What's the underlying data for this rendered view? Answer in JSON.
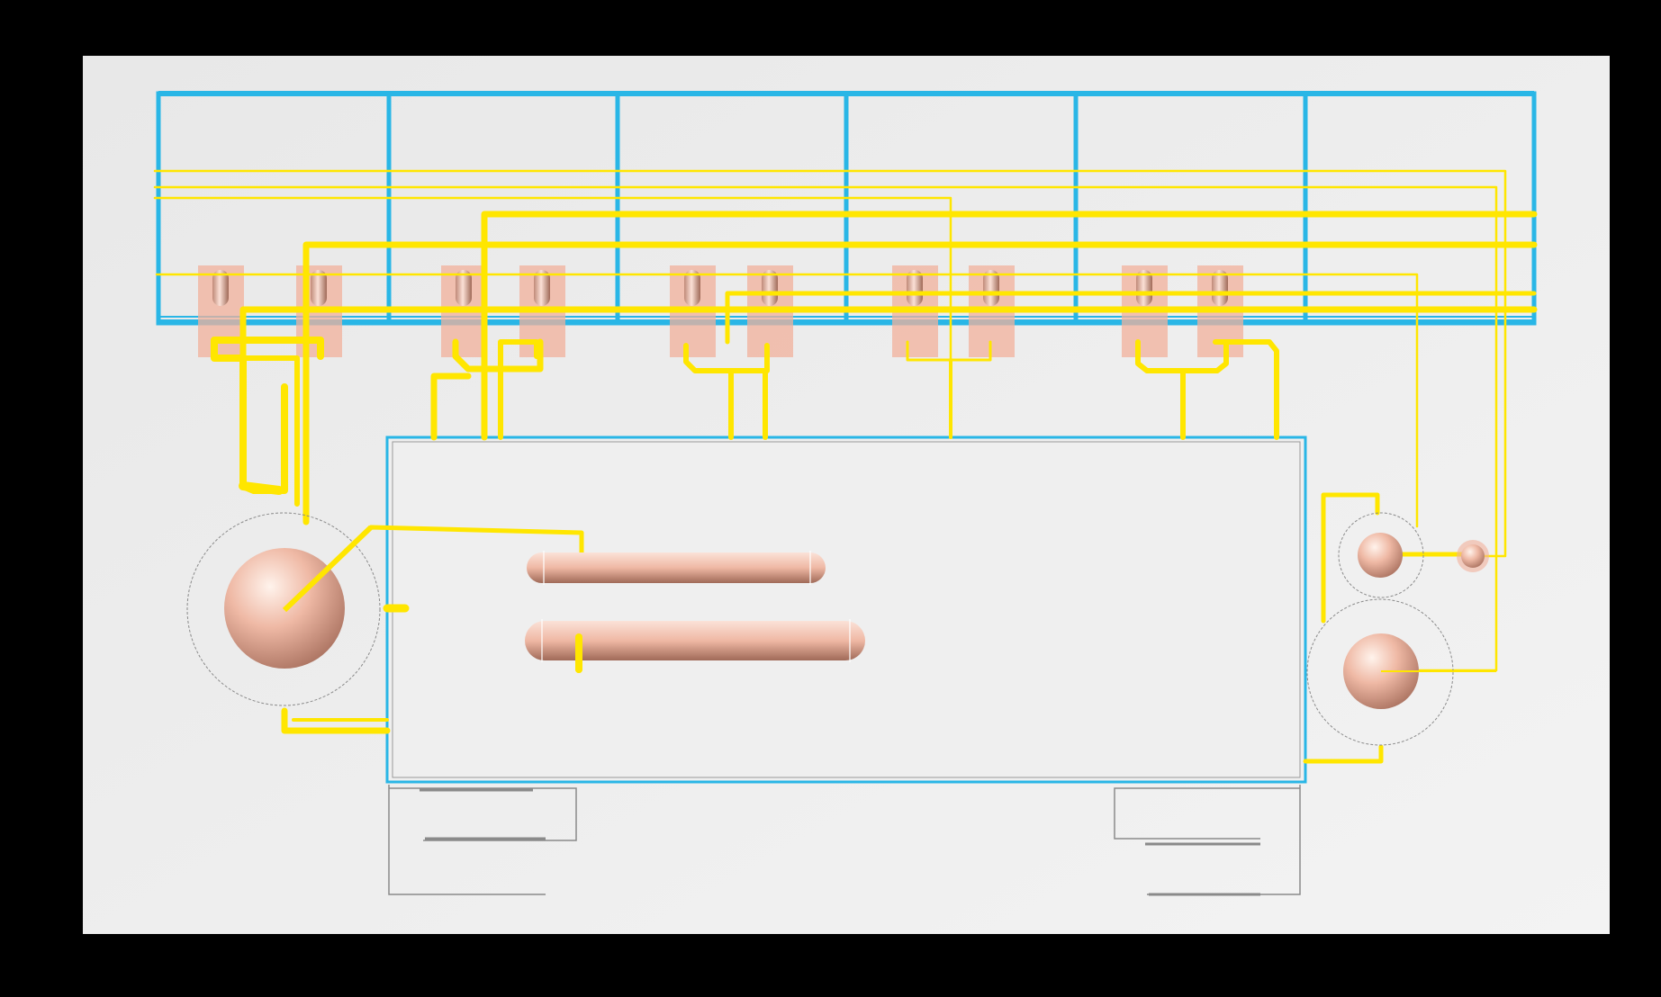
{
  "scene": {
    "background": "#000000",
    "canvas_color": "#ededed",
    "frame_color": "#29b6e6",
    "pipe_color": "#ffe600",
    "pipe_dark_color": "#c9a800",
    "vessel_color": "#efb7a3",
    "vessel_dark_color": "#b37a66",
    "highlight_color": "#f4a890",
    "outline_color": "#8a8a8a"
  },
  "icons": {
    "sphere": "sphere-vessel-icon",
    "drum": "horizontal-drum-icon",
    "column": "vertical-vessel-icon"
  }
}
